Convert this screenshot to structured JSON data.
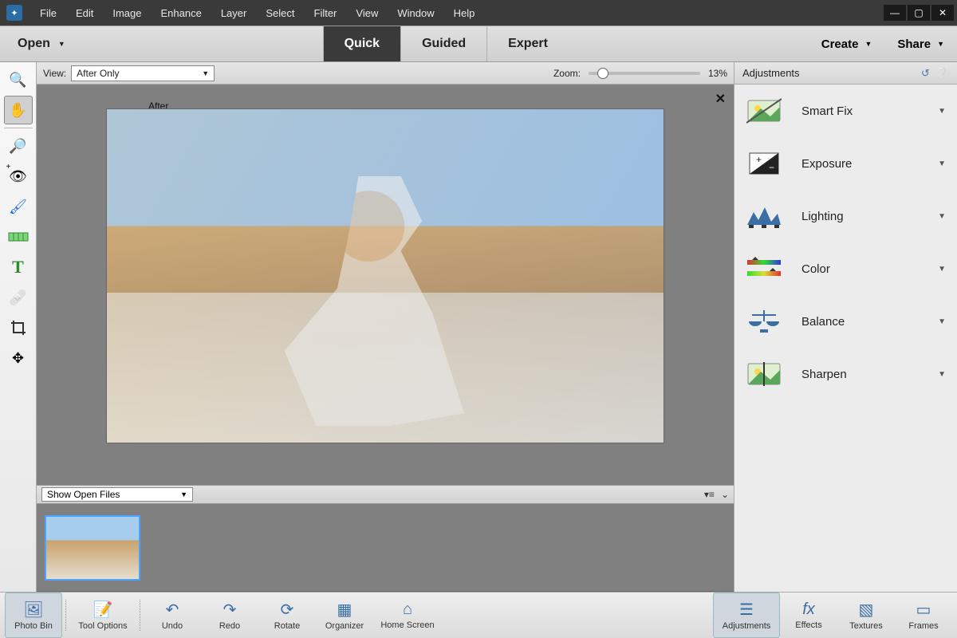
{
  "menu": {
    "items": [
      "File",
      "Edit",
      "Image",
      "Enhance",
      "Layer",
      "Select",
      "Filter",
      "View",
      "Window",
      "Help"
    ]
  },
  "modebar": {
    "open": "Open",
    "tabs": [
      {
        "label": "Quick",
        "active": true
      },
      {
        "label": "Guided",
        "active": false
      },
      {
        "label": "Expert",
        "active": false
      }
    ],
    "create": "Create",
    "share": "Share"
  },
  "tools": [
    {
      "name": "zoom-tool",
      "glyph": "🔍",
      "active": false
    },
    {
      "name": "hand-tool",
      "glyph": "✋",
      "active": true
    },
    {
      "name": "separator"
    },
    {
      "name": "quick-select-tool",
      "glyph": "🔎",
      "active": false
    },
    {
      "name": "eye-tool",
      "glyph": "👁",
      "active": false,
      "plus": true
    },
    {
      "name": "brush-tool",
      "glyph": "🖌",
      "active": false
    },
    {
      "name": "straighten-tool",
      "glyph": "🟩",
      "active": false
    },
    {
      "name": "type-tool",
      "glyph": "T",
      "active": false,
      "color": "#2e8b2e",
      "bold": true
    },
    {
      "name": "healing-tool",
      "glyph": "🩹",
      "active": false
    },
    {
      "name": "crop-tool",
      "glyph": "✂",
      "active": false
    },
    {
      "name": "move-tool",
      "glyph": "✥",
      "active": false
    }
  ],
  "viewstrip": {
    "view_label": "View:",
    "view_value": "After Only",
    "zoom_label": "Zoom:",
    "zoom_value": "13%"
  },
  "canvas": {
    "after_label": "After"
  },
  "openfiles": {
    "label": "Show Open Files"
  },
  "rightpanel": {
    "title": "Adjustments",
    "items": [
      {
        "name": "smart-fix",
        "label": "Smart Fix"
      },
      {
        "name": "exposure",
        "label": "Exposure"
      },
      {
        "name": "lighting",
        "label": "Lighting"
      },
      {
        "name": "color",
        "label": "Color"
      },
      {
        "name": "balance",
        "label": "Balance"
      },
      {
        "name": "sharpen",
        "label": "Sharpen"
      }
    ]
  },
  "bottombar": {
    "left": [
      {
        "name": "photo-bin",
        "label": "Photo Bin",
        "glyph": "🖼",
        "active": true
      },
      {
        "name": "tool-options",
        "label": "Tool Options",
        "glyph": "📝"
      }
    ],
    "mid": [
      {
        "name": "undo",
        "label": "Undo",
        "glyph": "↶"
      },
      {
        "name": "redo",
        "label": "Redo",
        "glyph": "↷"
      },
      {
        "name": "rotate",
        "label": "Rotate",
        "glyph": "⟳"
      },
      {
        "name": "organizer",
        "label": "Organizer",
        "glyph": "▦"
      },
      {
        "name": "home-screen",
        "label": "Home Screen",
        "glyph": "⌂"
      }
    ],
    "right": [
      {
        "name": "adjustments",
        "label": "Adjustments",
        "glyph": "⚙",
        "active": true
      },
      {
        "name": "effects",
        "label": "Effects",
        "glyph": "fx"
      },
      {
        "name": "textures",
        "label": "Textures",
        "glyph": "▧"
      },
      {
        "name": "frames",
        "label": "Frames",
        "glyph": "▭"
      }
    ]
  }
}
